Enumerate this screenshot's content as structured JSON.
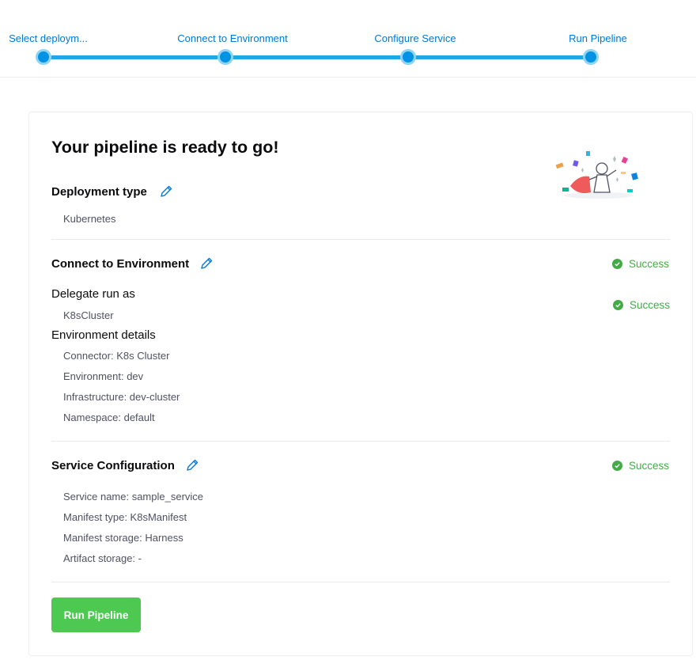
{
  "stepper": {
    "steps": [
      {
        "label": "Select deploym..."
      },
      {
        "label": "Connect to Environment"
      },
      {
        "label": "Configure Service"
      },
      {
        "label": "Run Pipeline"
      }
    ],
    "accent_color": "#0092e4"
  },
  "card": {
    "title": "Your pipeline is ready to go!",
    "deployment": {
      "heading": "Deployment type",
      "value": "Kubernetes"
    },
    "environment": {
      "heading": "Connect to Environment",
      "status": "Success",
      "delegate_heading": "Delegate run as",
      "delegate_value": "K8sCluster",
      "delegate_status": "Success",
      "details_heading": "Environment details",
      "details": [
        "Connector: K8s Cluster",
        "Environment: dev",
        "Infrastructure: dev-cluster",
        "Namespace: default"
      ]
    },
    "service": {
      "heading": "Service Configuration",
      "status": "Success",
      "details": [
        "Service name: sample_service",
        "Manifest type: K8sManifest",
        "Manifest storage: Harness",
        "Artifact storage: -"
      ]
    },
    "run_button_label": "Run Pipeline",
    "success_color": "#42ab45",
    "button_color": "#4dc952",
    "illustration_icon": "celebration-illustration"
  }
}
